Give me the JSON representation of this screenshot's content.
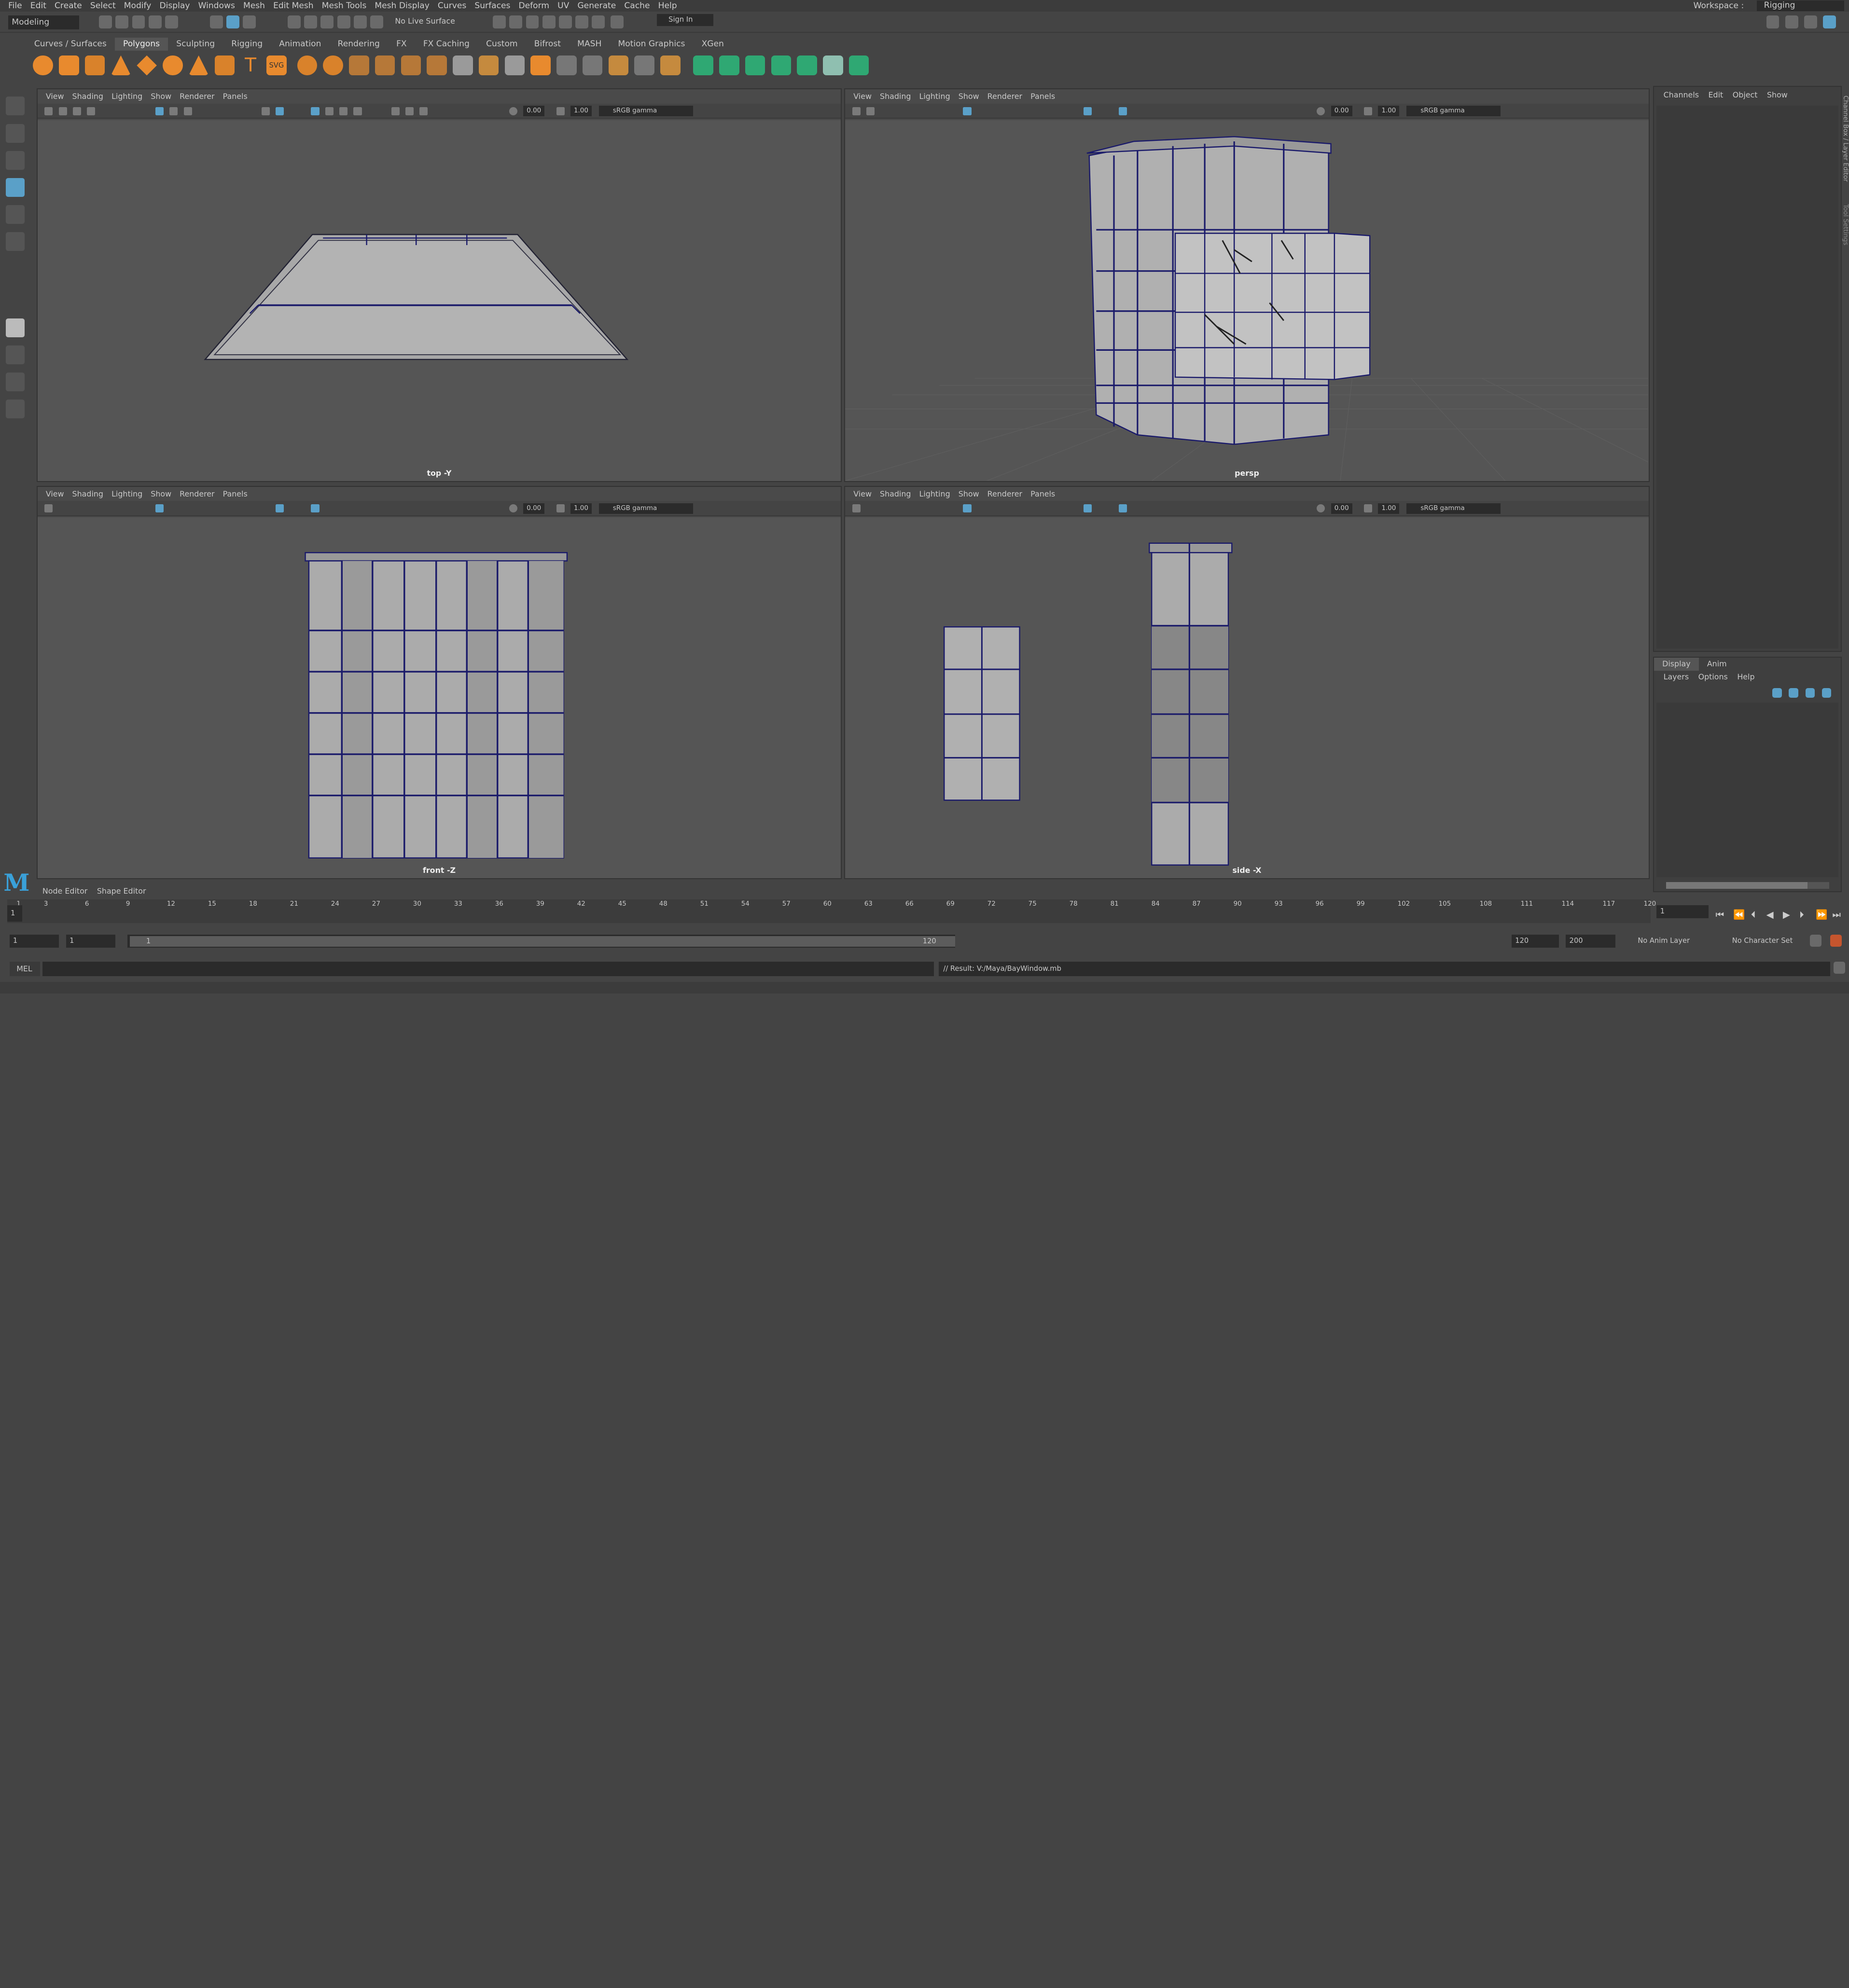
{
  "menus": [
    "File",
    "Edit",
    "Create",
    "Select",
    "Modify",
    "Display",
    "Windows",
    "Mesh",
    "Edit Mesh",
    "Mesh Tools",
    "Mesh Display",
    "Curves",
    "Surfaces",
    "Deform",
    "UV",
    "Generate",
    "Cache",
    "Help"
  ],
  "workspace": {
    "label": "Workspace :",
    "value": "Rigging"
  },
  "status": {
    "mode": "Modeling",
    "live_surface": "No Live Surface",
    "sign_in": "Sign In"
  },
  "shelf_tabs": [
    "Curves / Surfaces",
    "Polygons",
    "Sculpting",
    "Rigging",
    "Animation",
    "Rendering",
    "FX",
    "FX Caching",
    "Custom",
    "Bifrost",
    "MASH",
    "Motion Graphics",
    "XGen"
  ],
  "viewport_menu": [
    "View",
    "Shading",
    "Lighting",
    "Show",
    "Renderer",
    "Panels"
  ],
  "viewport_toolbar": {
    "exposure": "0.00",
    "gamma": "1.00",
    "color_space": "sRGB gamma"
  },
  "viewports": {
    "top": "top -Y",
    "persp": "persp",
    "front": "front -Z",
    "side": "side -X"
  },
  "channel_box": {
    "menu": [
      "Channels",
      "Edit",
      "Object",
      "Show"
    ],
    "side_tabs": [
      "Channel Box / Layer Editor",
      "Tool Settings"
    ]
  },
  "layer_editor": {
    "tabs": [
      "Display",
      "Anim"
    ],
    "menu": [
      "Layers",
      "Options",
      "Help"
    ]
  },
  "editor_tabs": [
    "Node Editor",
    "Shape Editor"
  ],
  "timeline": {
    "ticks": [
      "1",
      "3",
      "6",
      "9",
      "12",
      "15",
      "18",
      "21",
      "24",
      "27",
      "30",
      "33",
      "36",
      "39",
      "42",
      "45",
      "48",
      "51",
      "54",
      "57",
      "60",
      "63",
      "66",
      "69",
      "72",
      "75",
      "78",
      "81",
      "84",
      "87",
      "90",
      "93",
      "96",
      "99",
      "102",
      "105",
      "108",
      "111",
      "114",
      "117",
      "120"
    ],
    "current_frame": "1",
    "frame_field": "1"
  },
  "range": {
    "start": "1",
    "anim_start": "1",
    "range_start": "1",
    "range_end": "120",
    "end": "120",
    "anim_end": "200",
    "anim_layer": "No Anim Layer",
    "char_set": "No Character Set"
  },
  "command": {
    "lang": "MEL",
    "result": "// Result: V:/Maya/BayWindow.mb"
  },
  "icons": [
    "select-tool-icon",
    "lasso-icon",
    "paint-icon",
    "scale-tool-icon",
    "rotate-tool-icon",
    "move-tool-icon",
    "sphere-icon",
    "cube-icon",
    "cylinder-icon",
    "cone-icon",
    "plane-icon",
    "torus-icon",
    "text-icon",
    "svg-icon",
    "play-icon"
  ]
}
